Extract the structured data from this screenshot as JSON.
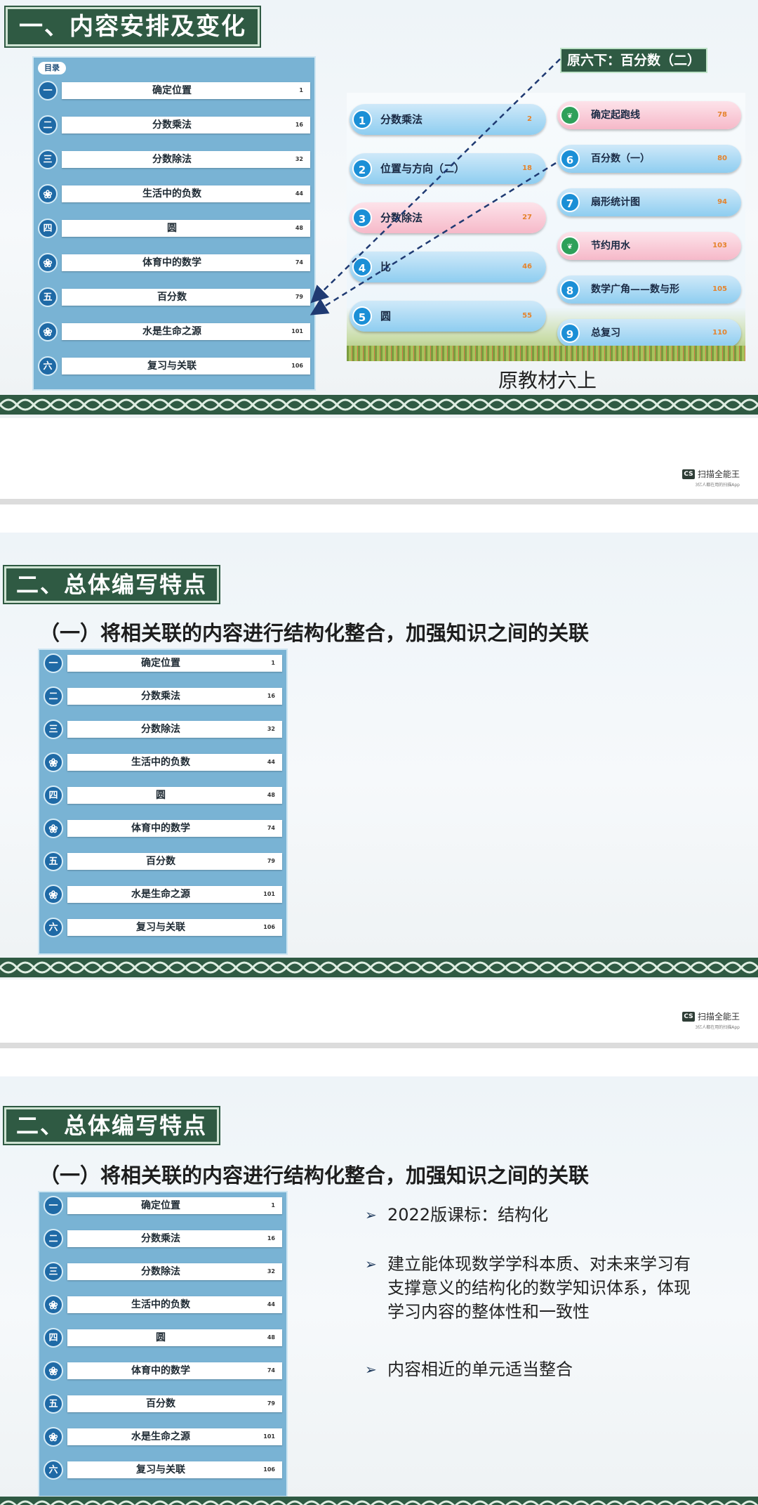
{
  "watermark": {
    "name": "扫描全能王",
    "sub": "3亿人都在用的扫描App",
    "logo": "CS"
  },
  "toc_items": [
    {
      "icon": "一",
      "label": "确定位置",
      "page": "1"
    },
    {
      "icon": "二",
      "label": "分数乘法",
      "page": "16"
    },
    {
      "icon": "三",
      "label": "分数除法",
      "page": "32"
    },
    {
      "icon": "circles",
      "label": "生活中的负数",
      "page": "44"
    },
    {
      "icon": "四",
      "label": "圆",
      "page": "48"
    },
    {
      "icon": "circles",
      "label": "体育中的数学",
      "page": "74"
    },
    {
      "icon": "五",
      "label": "百分数",
      "page": "79"
    },
    {
      "icon": "circles",
      "label": "水是生命之源",
      "page": "101"
    },
    {
      "icon": "六",
      "label": "复习与关联",
      "page": "106"
    }
  ],
  "slide1": {
    "title": "一、内容安排及变化",
    "toc_header": "目录",
    "callout": "原六下：百分数（二）",
    "caption": "原教材六上",
    "left_units": [
      {
        "num": "1",
        "label": "分数乘法",
        "page": "2",
        "style": "blue"
      },
      {
        "num": "2",
        "label": "位置与方向（二）",
        "page": "18",
        "style": "blue"
      },
      {
        "num": "3",
        "label": "分数除法",
        "page": "27",
        "style": "pink"
      },
      {
        "num": "4",
        "label": "比",
        "page": "46",
        "style": "blue"
      },
      {
        "num": "5",
        "label": "圆",
        "page": "55",
        "style": "blue"
      }
    ],
    "right_units": [
      {
        "num": "leaf",
        "label": "确定起跑线",
        "page": "78",
        "style": "pink"
      },
      {
        "num": "6",
        "label": "百分数（一）",
        "page": "80",
        "style": "blue"
      },
      {
        "num": "7",
        "label": "扇形统计图",
        "page": "94",
        "style": "blue"
      },
      {
        "num": "leaf",
        "label": "节约用水",
        "page": "103",
        "style": "pink"
      },
      {
        "num": "8",
        "label": "数学广角——数与形",
        "page": "105",
        "style": "blue"
      },
      {
        "num": "9",
        "label": "总复习",
        "page": "110",
        "style": "blue"
      }
    ]
  },
  "slide2": {
    "title": "二、总体编写特点",
    "subtitle": "（一）将相关联的内容进行结构化整合，加强知识之间的关联"
  },
  "slide3": {
    "title": "二、总体编写特点",
    "subtitle": "（一）将相关联的内容进行结构化整合，加强知识之间的关联",
    "bullets": [
      {
        "marker": "➢",
        "text": "2022版课标：结构化"
      },
      {
        "marker": "➢",
        "text": "建立能体现数学学科本质、对未来学习有支撑意义的结构化的数学知识体系，体现学习内容的整体性和一致性"
      },
      {
        "marker": "➢",
        "text": "内容相近的单元适当整合"
      }
    ]
  }
}
